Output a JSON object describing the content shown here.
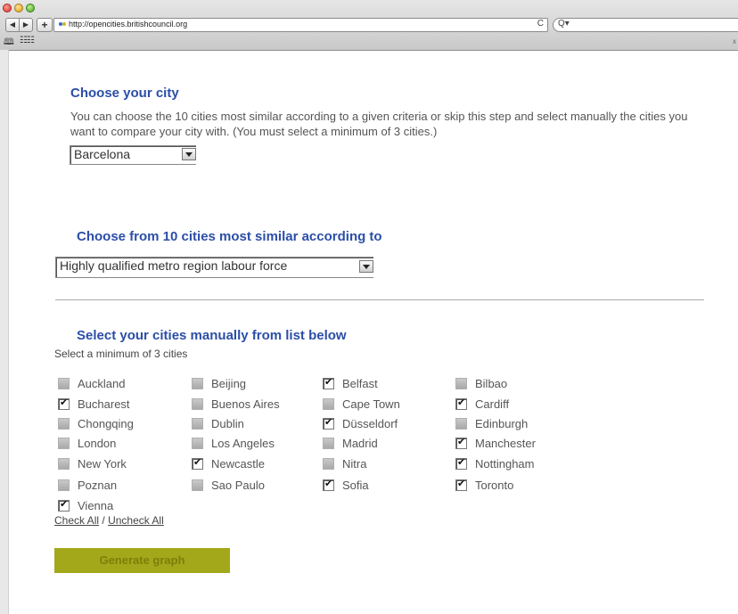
{
  "browser": {
    "url": "http://opencities.britishcouncil.org",
    "back_glyph": "◀",
    "forward_glyph": "▶",
    "add_glyph": "+",
    "reload_glyph": "C",
    "search_glyph": "Q▾",
    "close_glyph": "x"
  },
  "choose_city": {
    "title": "Choose your city",
    "description": "You can choose the 10 cities most similar according to a given criteria or skip this step and select manually the cities you want to compare your city with. (You must select a minimum of 3 cities.)",
    "selected": "Barcelona"
  },
  "similar": {
    "title": "Choose from 10 cities most similar according to",
    "criteria": "Highly qualified metro region labour force"
  },
  "manual": {
    "title": "Select your cities manually from list below",
    "hint": "Select a minimum of 3 cities",
    "cities": [
      {
        "name": "Auckland",
        "checked": false
      },
      {
        "name": "Beijing",
        "checked": false
      },
      {
        "name": "Belfast",
        "checked": true
      },
      {
        "name": "Bilbao",
        "checked": false
      },
      {
        "name": "Bucharest",
        "checked": true
      },
      {
        "name": "Buenos Aires",
        "checked": false
      },
      {
        "name": "Cape Town",
        "checked": false
      },
      {
        "name": "Cardiff",
        "checked": true
      },
      {
        "name": "Chongqing",
        "checked": false
      },
      {
        "name": "Dublin",
        "checked": false
      },
      {
        "name": "Düsseldorf",
        "checked": true
      },
      {
        "name": "Edinburgh",
        "checked": false
      },
      {
        "name": "London",
        "checked": false
      },
      {
        "name": "Los Angeles",
        "checked": false
      },
      {
        "name": "Madrid",
        "checked": false
      },
      {
        "name": "Manchester",
        "checked": true
      },
      {
        "name": "New York",
        "checked": false
      },
      {
        "name": "Newcastle",
        "checked": true
      },
      {
        "name": "Nitra",
        "checked": false
      },
      {
        "name": "Nottingham",
        "checked": true
      },
      {
        "name": "Poznan",
        "checked": false
      },
      {
        "name": "Sao Paulo",
        "checked": false
      },
      {
        "name": "Sofia",
        "checked": true
      },
      {
        "name": "Toronto",
        "checked": true
      },
      {
        "name": "Vienna",
        "checked": true
      }
    ],
    "check_all": "Check All",
    "separator": "/",
    "uncheck_all": "Uncheck All"
  },
  "generate_button": "Generate graph",
  "colors": {
    "heading": "#2b4ea7",
    "button_bg": "#a3a81a",
    "button_text": "#7b7f0a"
  }
}
